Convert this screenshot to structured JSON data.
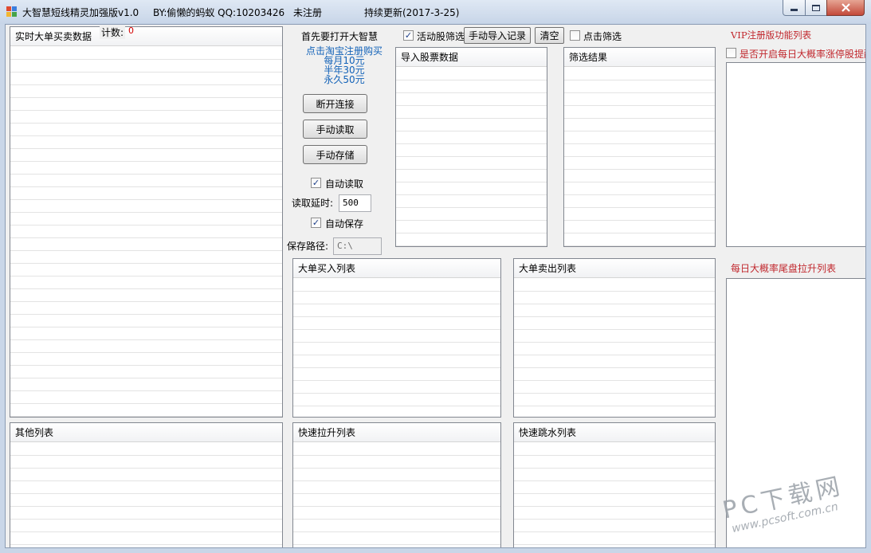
{
  "window": {
    "title": "大智慧短线精灵加强版v1.0",
    "author": "BY:偷懒的蚂蚁 QQ:10203426",
    "register_status": "未注册",
    "update_note": "持续更新(2017-3-25)"
  },
  "realtime_panel": {
    "header": "实时大单买卖数据",
    "count_label": "计数:",
    "count_value": "0"
  },
  "center": {
    "open_hint": "首先要打开大智慧",
    "purchase_lines": [
      "点击淘宝注册购买",
      "每月10元",
      "半年30元",
      "永久50元"
    ],
    "disconnect_label": "断开连接",
    "manual_read_label": "手动读取",
    "manual_save_label": "手动存储",
    "auto_read_label": "自动读取",
    "auto_read_checked": true,
    "read_delay_label": "读取延时:",
    "read_delay_value": "500",
    "auto_save_label": "自动保存",
    "auto_save_checked": true,
    "save_path_label": "保存路径:",
    "save_path_value": "C:\\"
  },
  "filter_bar": {
    "active_filter_label": "活动股筛选",
    "active_filter_checked": true,
    "manual_import_label": "手动导入记录",
    "clear_label": "清空",
    "click_filter_label": "点击筛选",
    "click_filter_checked": false
  },
  "import_panel": {
    "header": "导入股票数据"
  },
  "result_panel": {
    "header": "筛选结果"
  },
  "vip": {
    "title": "VIP注册版功能列表",
    "limit_up_label": "是否开启每日大概率涨停股提醒",
    "limit_up_checked": false,
    "tail_list_title": "每日大概率尾盘拉升列表"
  },
  "buy_panel": {
    "header": "大单买入列表"
  },
  "sell_panel": {
    "header": "大单卖出列表"
  },
  "other_panel": {
    "header": "其他列表"
  },
  "rapid_rise_panel": {
    "header": "快速拉升列表"
  },
  "rapid_fall_panel": {
    "header": "快速跳水列表"
  },
  "watermark": {
    "main": "PC下载网",
    "sub": "www.pcsoft.com.cn"
  },
  "colors": {
    "link_blue": "#1262b8",
    "vip_red": "#c1272d",
    "count_red": "#d40000"
  }
}
